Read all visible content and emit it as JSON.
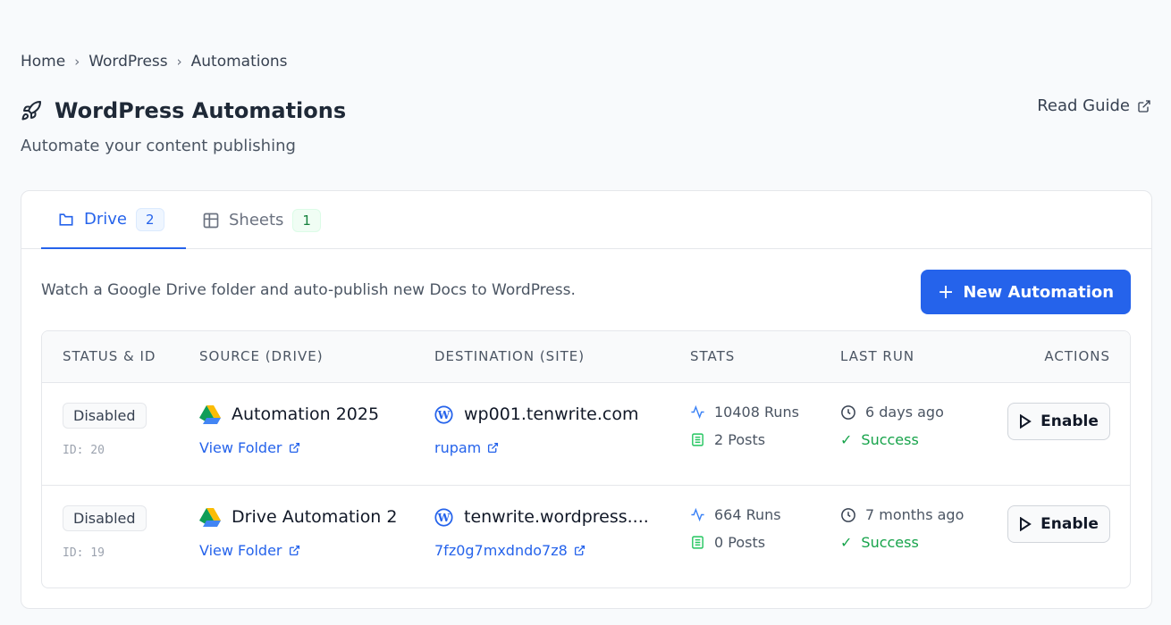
{
  "breadcrumb": [
    "Home",
    "WordPress",
    "Automations"
  ],
  "header": {
    "title": "WordPress Automations",
    "subtitle": "Automate your content publishing",
    "guide": "Read Guide"
  },
  "tabs": [
    {
      "label": "Drive",
      "count": "2"
    },
    {
      "label": "Sheets",
      "count": "1"
    }
  ],
  "description": "Watch a Google Drive folder and auto-publish new Docs to WordPress.",
  "new_button": "New Automation",
  "columns": [
    "STATUS & ID",
    "SOURCE (DRIVE)",
    "DESTINATION (SITE)",
    "STATS",
    "LAST RUN",
    "ACTIONS"
  ],
  "rows": [
    {
      "status": "Disabled",
      "id": "ID: 20",
      "source": "Automation 2025",
      "source_link": "View Folder",
      "site": "wp001.tenwrite.com",
      "site_user": "rupam",
      "runs": "10408 Runs",
      "posts": "2 Posts",
      "last_run": "6 days ago",
      "result": "Success",
      "action": "Enable"
    },
    {
      "status": "Disabled",
      "id": "ID: 19",
      "source": "Drive Automation 2",
      "source_link": "View Folder",
      "site": "tenwrite.wordpress....",
      "site_user": "7fz0g7mxdndo7z8",
      "runs": "664 Runs",
      "posts": "0 Posts",
      "last_run": "7 months ago",
      "result": "Success",
      "action": "Enable"
    }
  ],
  "colors": {
    "accent": "#2563eb",
    "success": "#16a34a"
  }
}
